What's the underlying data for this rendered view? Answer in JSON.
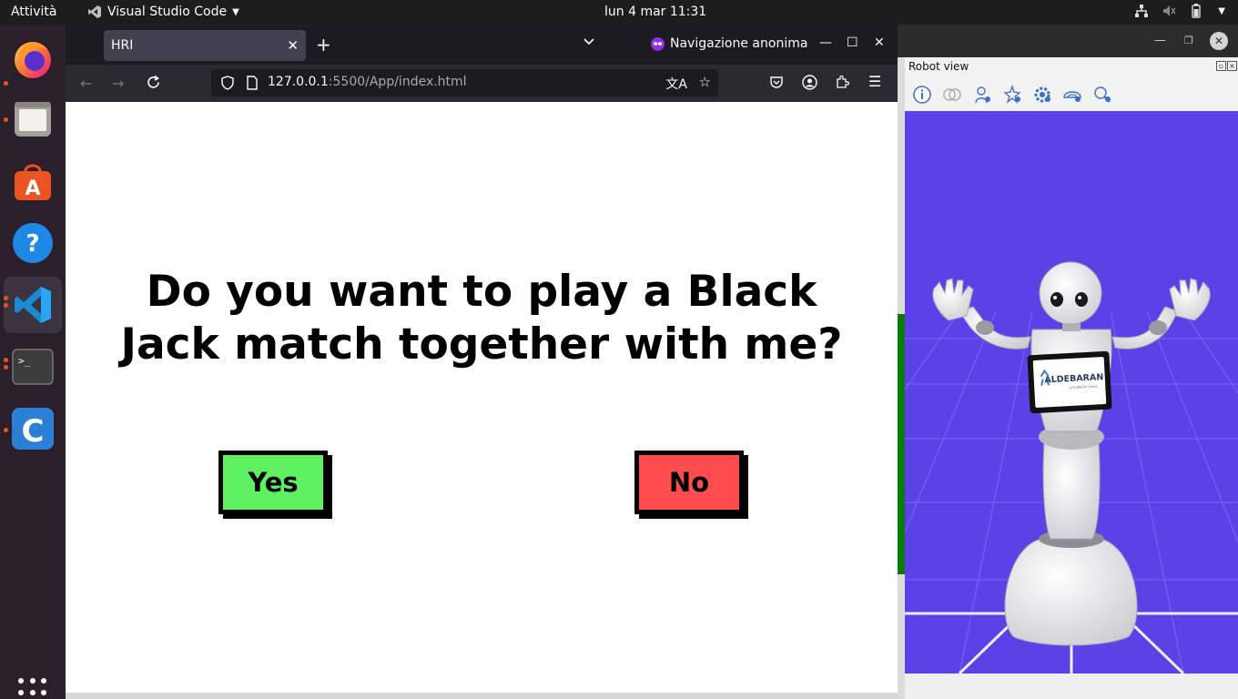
{
  "topbar": {
    "activities": "Attività",
    "app_name": "Visual Studio Code",
    "clock": "lun 4 mar  11:31"
  },
  "dock": {
    "items": [
      {
        "name": "firefox",
        "icon": "firefox-icon"
      },
      {
        "name": "files",
        "icon": "files-icon"
      },
      {
        "name": "app-center",
        "icon": "app-center-icon"
      },
      {
        "name": "help",
        "icon": "help-icon"
      },
      {
        "name": "vscode",
        "icon": "vscode-icon"
      },
      {
        "name": "terminal",
        "icon": "terminal-icon"
      },
      {
        "name": "choregraphe",
        "icon": "choregraphe-icon"
      }
    ],
    "show_apps_icon": "apps-grid-icon"
  },
  "browser": {
    "tab_title": "HRI",
    "private_label": "Navigazione anonima",
    "url_host": "127.0.0.1",
    "url_rest": ":5500/App/index.html",
    "accent": "#8f2ee6"
  },
  "page": {
    "question": "Do you want to play a Black Jack match together with me?",
    "yes_label": "Yes",
    "no_label": "No",
    "yes_color": "#5ef060",
    "no_color": "#ff4d4d"
  },
  "robot_view": {
    "title": "Robot view",
    "scene_color": "#5b41e6",
    "tablet_brand": "ALDEBARAN",
    "tablet_subtext": "a SoftBank Group"
  }
}
